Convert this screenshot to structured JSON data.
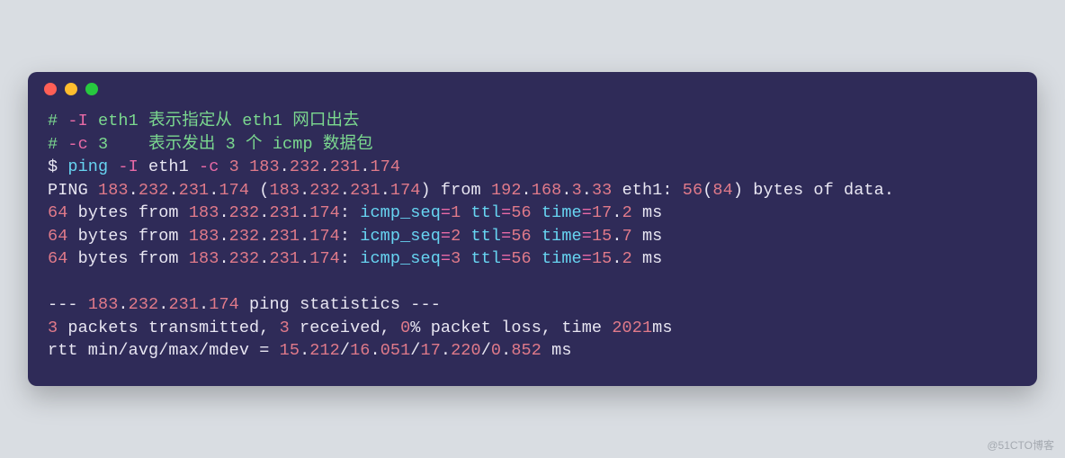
{
  "watermark": "@51CTO博客",
  "comments": [
    {
      "hash": "#",
      "flag": "-I",
      "arg": "eth1",
      "text1": " 表示指定从 ",
      "kw": "eth1",
      "text2": " 网口出去"
    },
    {
      "hash": "#",
      "flag": "-c",
      "arg": "3",
      "text1": "    表示发出 ",
      "kw": "3",
      "text2": " 个 ",
      "kw2": "icmp",
      "text3": " 数据包"
    }
  ],
  "prompt": "$",
  "command": {
    "name": "ping",
    "flag1": "-I",
    "arg1": "eth1",
    "flag2": "-c",
    "arg2": "3",
    "ip": "183.232.231.174",
    "ip_parts": [
      "183",
      "232",
      "231",
      "174"
    ]
  },
  "ping_header": {
    "label": "PING",
    "ip_parts": [
      "183",
      "232",
      "231",
      "174"
    ],
    "paren_open": "(",
    "paren_close": ")",
    "from_label": " from ",
    "src_parts": [
      "192",
      "168",
      "3",
      "33"
    ],
    "iface": "eth1",
    "colon": ": ",
    "size1": "56",
    "paren2o": "(",
    "size2": "84",
    "paren2c": ")",
    "tail": " bytes of data."
  },
  "replies": [
    {
      "bytes": "64",
      "ip_parts": [
        "183",
        "232",
        "231",
        "174"
      ],
      "seq": "1",
      "ttl": "56",
      "time": "17",
      "time_frac": "2"
    },
    {
      "bytes": "64",
      "ip_parts": [
        "183",
        "232",
        "231",
        "174"
      ],
      "seq": "2",
      "ttl": "56",
      "time": "15",
      "time_frac": "7"
    },
    {
      "bytes": "64",
      "ip_parts": [
        "183",
        "232",
        "231",
        "174"
      ],
      "seq": "3",
      "ttl": "56",
      "time": "15",
      "time_frac": "2"
    }
  ],
  "stats_hdr": {
    "dashes": "---",
    "ip_parts": [
      "183",
      "232",
      "231",
      "174"
    ],
    "tail": " ping statistics ",
    "dashes2": "---"
  },
  "stats_line1": {
    "tx": "3",
    "txt1": " packets transmitted, ",
    "rx": "3",
    "txt2": " received, ",
    "loss": "0",
    "txt3": "% packet loss, time ",
    "time": "2021",
    "txt4": "ms"
  },
  "stats_line2": {
    "prefix": "rtt min/avg/max/mdev = ",
    "v1a": "15",
    "v1b": "212",
    "v2a": "16",
    "v2b": "051",
    "v3a": "17",
    "v3b": "220",
    "v4a": "0",
    "v4b": "852",
    "unit": " ms"
  }
}
